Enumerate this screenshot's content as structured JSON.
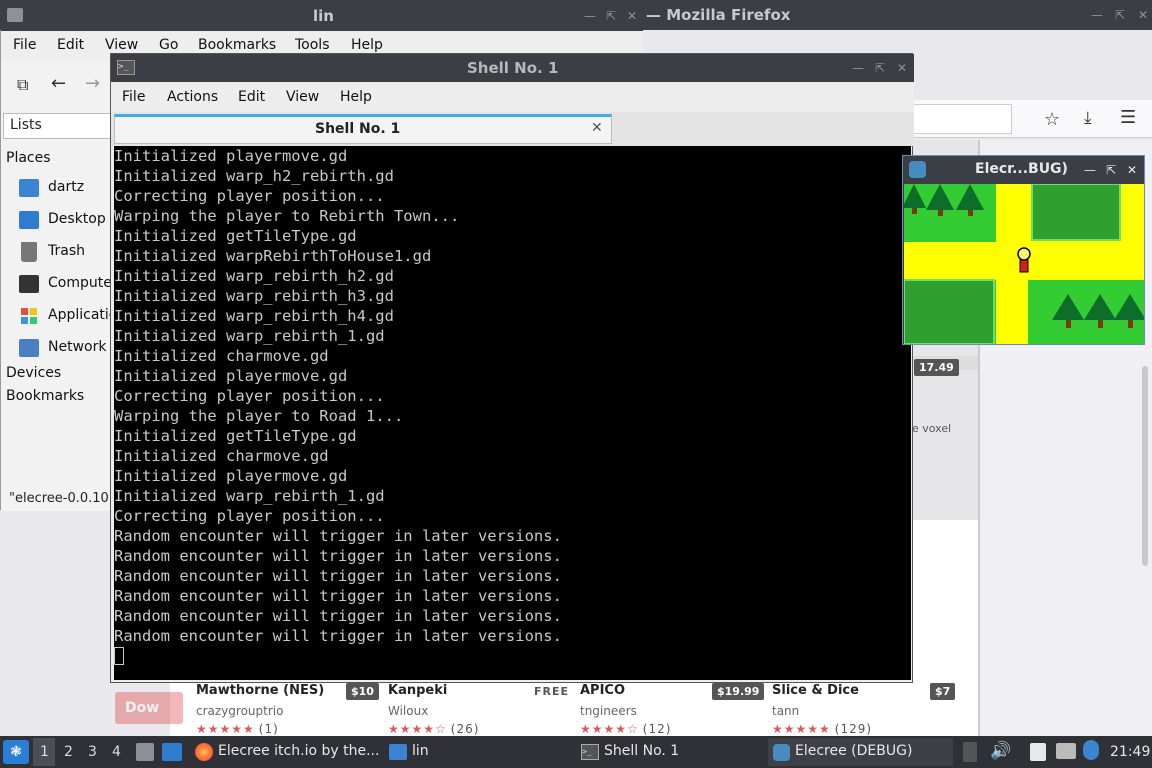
{
  "firefox": {
    "title": "— Mozilla Firefox",
    "price_badge": "17.49",
    "side_text": "e voxel",
    "download_label": "Dow",
    "games": [
      {
        "title": "Mawthorne (NES)",
        "author": "crazygrouptrio",
        "price": "$10",
        "rating_count": "(1)"
      },
      {
        "title": "Kanpeki",
        "author": "Wiloux",
        "price": "FREE",
        "rating_count": "(26)"
      },
      {
        "title": "APICO",
        "author": "tngineers",
        "price": "$19.99",
        "rating_count": "(12)"
      },
      {
        "title": "Slice & Dice",
        "author": "tann",
        "price": "$7",
        "rating_count": "(129)"
      }
    ]
  },
  "file_manager": {
    "title": "lin",
    "menu": [
      "File",
      "Edit",
      "View",
      "Go",
      "Bookmarks",
      "Tools",
      "Help"
    ],
    "view_mode": "Lists",
    "places_label": "Places",
    "places": [
      {
        "label": "dartz",
        "icon": "home-folder-icon"
      },
      {
        "label": "Desktop",
        "icon": "desktop-icon"
      },
      {
        "label": "Trash",
        "icon": "trash-icon"
      },
      {
        "label": "Compute",
        "icon": "computer-icon"
      },
      {
        "label": "Applicatio",
        "icon": "applications-icon"
      },
      {
        "label": "Network",
        "icon": "network-icon"
      }
    ],
    "devices_label": "Devices",
    "bookmarks_label": "Bookmarks",
    "status": "\"elecree-0.0.10"
  },
  "terminal": {
    "title": "Shell No. 1",
    "menu": [
      "File",
      "Actions",
      "Edit",
      "View",
      "Help"
    ],
    "tab_label": "Shell No. 1",
    "lines": [
      "Initialized playermove.gd",
      "Initialized warp_h2_rebirth.gd",
      "Correcting player position...",
      "Warping the player to Rebirth Town...",
      "Initialized getTileType.gd",
      "Initialized warpRebirthToHouse1.gd",
      "Initialized warp_rebirth_h2.gd",
      "Initialized warp_rebirth_h3.gd",
      "Initialized warp_rebirth_h4.gd",
      "Initialized warp_rebirth_1.gd",
      "Initialized charmove.gd",
      "Initialized playermove.gd",
      "Correcting player position...",
      "Warping the player to Road 1...",
      "Initialized getTileType.gd",
      "Initialized charmove.gd",
      "Initialized playermove.gd",
      "Initialized warp_rebirth_1.gd",
      "Correcting player position...",
      "Random encounter will trigger in later versions.",
      "Random encounter will trigger in later versions.",
      "Random encounter will trigger in later versions.",
      "Random encounter will trigger in later versions.",
      "Random encounter will trigger in later versions.",
      "Random encounter will trigger in later versions."
    ]
  },
  "game_window": {
    "title": "Elecr...BUG)"
  },
  "taskbar": {
    "workspaces": [
      "1",
      "2",
      "3",
      "4"
    ],
    "active_workspace": "1",
    "tasks": [
      {
        "label": "Elecree itch.io by the...",
        "icon": "firefox-icon"
      },
      {
        "label": "lin",
        "icon": "folder-icon"
      },
      {
        "label": "Shell No. 1",
        "icon": "terminal-icon"
      },
      {
        "label": "Elecree (DEBUG)",
        "icon": "godot-icon"
      }
    ],
    "clock": "21:49"
  },
  "colors": {
    "accent": "#3daee9",
    "titlebar": "#3b3e44",
    "terminal_bg": "#000000",
    "terminal_fg": "#c8c8c8",
    "grass": "#33cc33",
    "path": "#ffff00",
    "rating": "#de5a5a"
  }
}
